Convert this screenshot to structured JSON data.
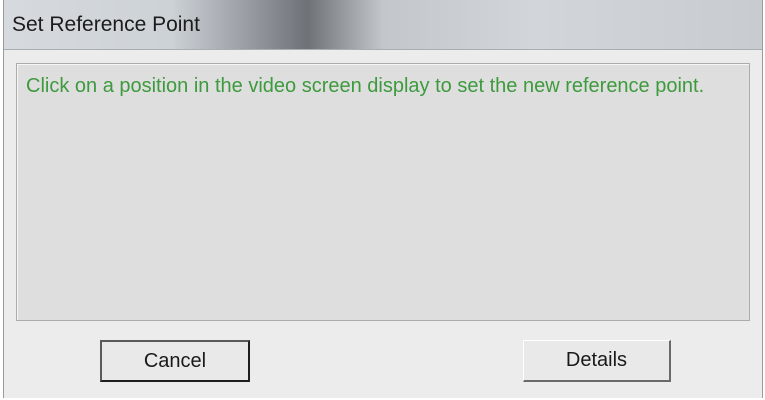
{
  "window": {
    "title": "Set Reference Point"
  },
  "message": {
    "text": "Click on a position in the video screen display to set the new reference point."
  },
  "buttons": {
    "cancel_label": "Cancel",
    "details_label": "Details"
  },
  "colors": {
    "message_text": "#3d9a3d",
    "dialog_background": "#ececec"
  }
}
